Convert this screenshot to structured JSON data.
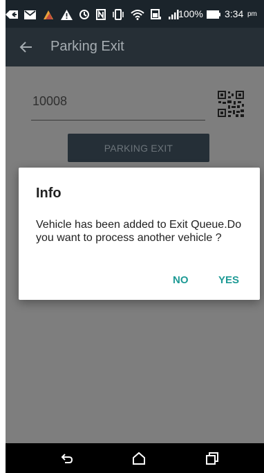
{
  "status_bar": {
    "battery_percent": "100%",
    "time": "3:34",
    "time_suffix": "pm",
    "icons": [
      "back-notification-icon",
      "mail-icon",
      "app-notification-icon",
      "warning-icon",
      "sync-icon",
      "nfc-icon",
      "vibrate-icon",
      "wifi-icon",
      "battery-saver-icon",
      "signal-icon",
      "battery-icon"
    ]
  },
  "toolbar": {
    "title": "Parking Exit",
    "back_icon": "arrow-left-icon"
  },
  "form": {
    "vehicle_number": "10008",
    "qr_icon": "qr-code-icon",
    "exit_button_label": "PARKING EXIT"
  },
  "dialog": {
    "title": "Info",
    "message": "Vehicle has been added to Exit Queue.Do you want to process another vehicle ?",
    "no_label": "NO",
    "yes_label": "YES"
  },
  "nav_bar": {
    "icons": [
      "back-icon",
      "home-icon",
      "recents-icon"
    ]
  },
  "colors": {
    "accent": "#1e9a95",
    "toolbar": "#262f36",
    "status_bar": "#1b242b",
    "exit_button": "#252f37",
    "scrim": "#7e7e7e"
  }
}
